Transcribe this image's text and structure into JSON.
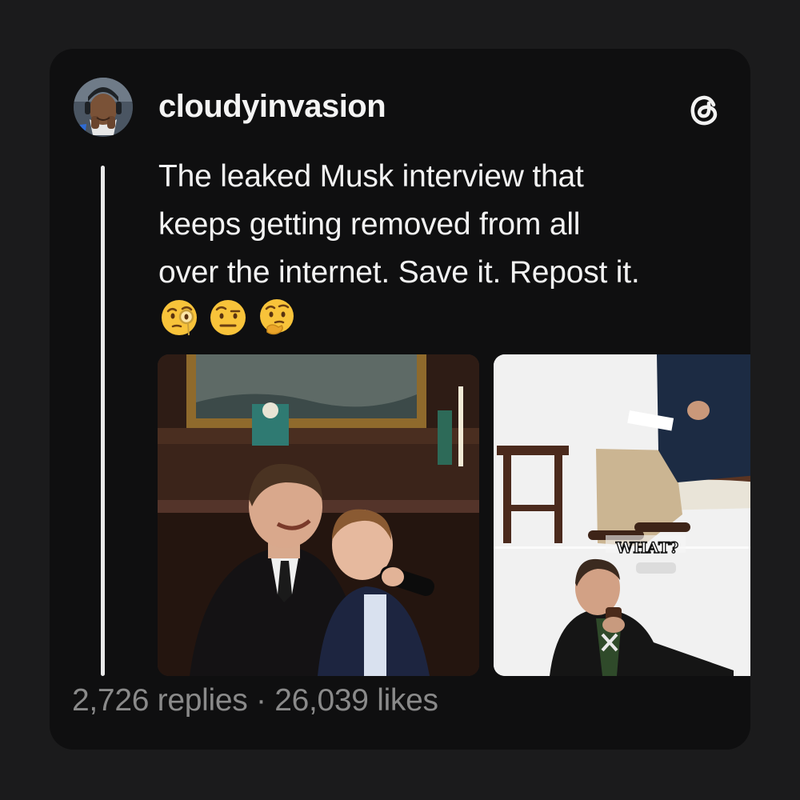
{
  "post": {
    "username": "cloudyinvasion",
    "text_lines": [
      "The leaked Musk interview that",
      "keeps getting removed from all",
      "over the internet. Save it. Repost it."
    ],
    "emojis": [
      "face-with-monocle",
      "face-with-raised-eyebrow",
      "thinking-face"
    ]
  },
  "media": [
    {
      "icon": "photo-thumbnail"
    },
    {
      "icon": "video-thumbnail",
      "caption": "WHAT?"
    }
  ],
  "stats": {
    "replies": "2,726 replies",
    "separator": " · ",
    "likes": "26,039 likes"
  },
  "colors": {
    "background": "#1b1b1c",
    "card": "#0f0f10",
    "text": "#f2f2f2",
    "muted": "#8a8a8a"
  }
}
